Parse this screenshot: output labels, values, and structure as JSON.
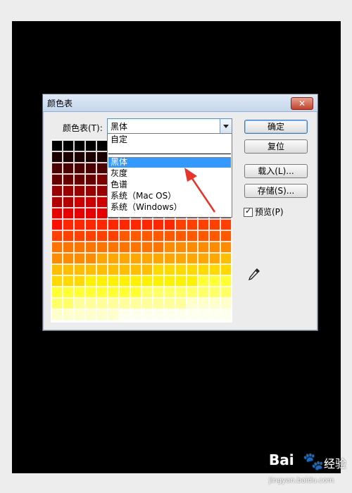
{
  "dialog": {
    "title": "颜色表",
    "close_label": "✕",
    "table_label": "颜色表(T):",
    "selected_value": "黑体",
    "dropdown": {
      "items": [
        "自定",
        "黑体",
        "灰度",
        "色谱",
        "系统（Mac OS）",
        "系统（Windows）"
      ],
      "highlighted": "黑体"
    },
    "buttons": {
      "ok": "确定",
      "reset": "复位",
      "load": "载入(L)...",
      "save": "存储(S)..."
    },
    "preview": {
      "label": "预览(P)",
      "checked": true
    }
  },
  "swatch_colors": [
    "#000000",
    "#1a0000",
    "#330000",
    "#4d0000",
    "#660000",
    "#800000",
    "#990000",
    "#b30000",
    "#cc0000",
    "#e60000",
    "#ff0d00",
    "#ff2600",
    "#ff4000",
    "#ff5900",
    "#ff7300",
    "#ff8c00",
    "#ffa600",
    "#ffbf00",
    "#ffd900",
    "#fff200",
    "#ffff33",
    "#ffff66",
    "#ffff99",
    "#ffffcc",
    "#ffffee"
  ],
  "watermark": {
    "brand": "Bai",
    "brand_tail": "经验",
    "url": "jingyan.baidu.com"
  },
  "annotation_color": "#e8322a"
}
